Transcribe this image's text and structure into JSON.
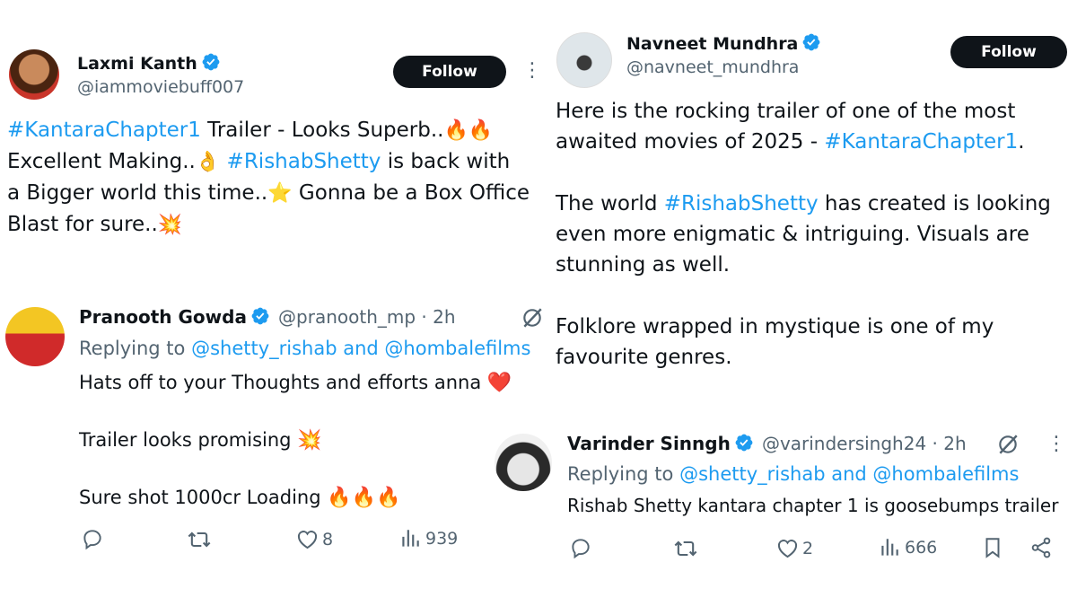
{
  "tweet1": {
    "name": "Laxmi Kanth",
    "handle": "@iammoviebuff007",
    "follow": "Follow",
    "more": "⋮",
    "lines": [
      {
        "tag": "#KantaraChapter1",
        "text": " Trailer - Looks Superb..",
        "emoji": "🔥🔥"
      },
      {
        "pre": "Excellent Making..",
        "emoji": "👌",
        "tag": "#RishabShetty",
        "text": " is back with"
      },
      {
        "pre": "a Bigger world this time..",
        "emoji": "⭐",
        "text": " Gonna be a Box Office"
      },
      {
        "pre": "Blast for sure..",
        "emoji": "💥"
      }
    ]
  },
  "tweet2": {
    "name": "Navneet Mundhra",
    "handle": "@navneet_mundhra",
    "follow": "Follow",
    "p1_line1": "Here is the rocking trailer of one of the most",
    "p1_line2_pre": "awaited movies of 2025 - ",
    "p1_line2_tag": "#KantaraChapter1",
    "p1_line2_post": ".",
    "p2_line1_pre": "The world ",
    "p2_line1_tag": "#RishabShetty",
    "p2_line1_post": " has created is looking",
    "p2_line2": "even more enigmatic & intriguing. Visuals are",
    "p2_line3": "stunning as well.",
    "p3_line1": "Folklore wrapped in mystique is one of my",
    "p3_line2": "favourite genres."
  },
  "reply1": {
    "name": "Pranooth Gowda",
    "handle": "@pranooth_mp · 2h",
    "replying_pre": "Replying to ",
    "replying_to": "@shetty_rishab and @hombalefilms",
    "line1": "Hats off to your Thoughts and efforts anna",
    "line1_emoji": "❤️",
    "line2": "Trailer looks promising",
    "line2_emoji": "💥",
    "line3": "Sure shot 1000cr Loading",
    "line3_emoji": "🔥🔥🔥",
    "likes": "8",
    "views": "939"
  },
  "reply2": {
    "name": "Varinder Sinngh",
    "handle": "@varindersingh24 · 2h",
    "replying_pre": "Replying to ",
    "replying_to": "@shetty_rishab and @hombalefilms",
    "line1": "Rishab Shetty kantara chapter 1 is goosebumps trailer",
    "likes": "2",
    "views": "666",
    "more": "⋮"
  },
  "icons": {
    "verified": "verified-badge-icon",
    "reply": "reply-icon",
    "retweet": "retweet-icon",
    "like": "heart-icon",
    "views": "views-icon",
    "bookmark": "bookmark-icon",
    "share": "share-icon",
    "grok": "grok-icon"
  },
  "colors": {
    "accent": "#1d9bf0",
    "text": "#0f1419",
    "muted": "#536471",
    "button": "#0f1419"
  }
}
